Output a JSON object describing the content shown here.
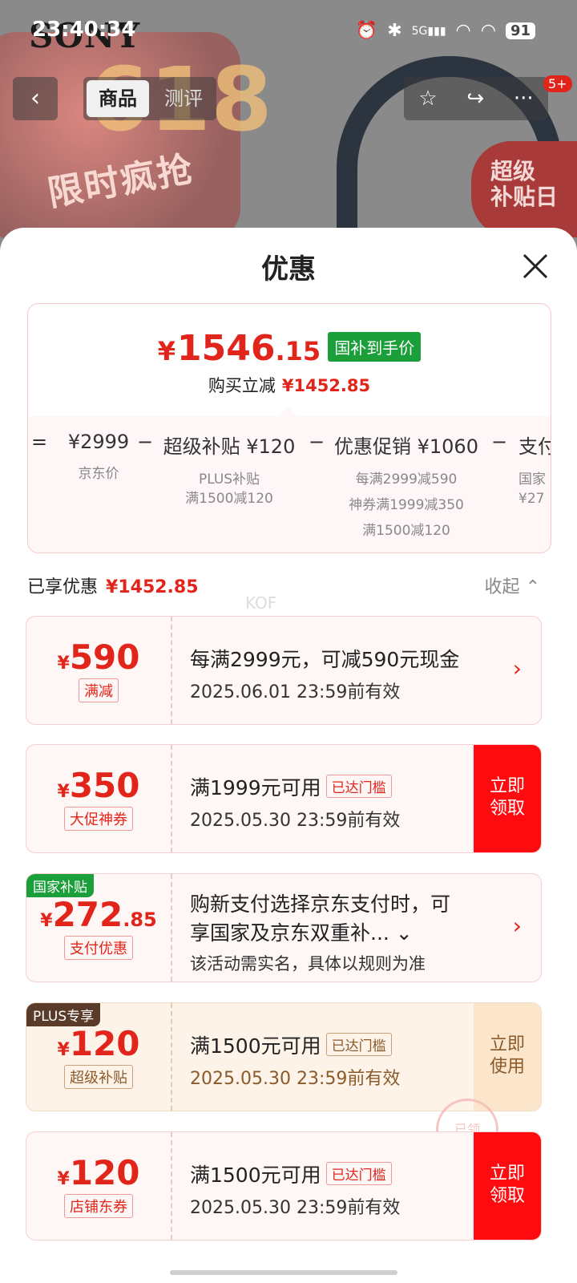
{
  "status": {
    "time": "23:40:34",
    "network": "5G",
    "battery": "91"
  },
  "background": {
    "brand": "SONY",
    "promo_big": "618",
    "promo_text": "限时疯抢",
    "badge": "超级\n补贴日"
  },
  "nav": {
    "tabs": [
      "商品",
      "测评"
    ],
    "badge": "5+"
  },
  "sheet": {
    "title": "优惠"
  },
  "summary": {
    "price_main": "1546",
    "price_decimal": ".15",
    "price_symbol": "¥",
    "price_tag": "国补到手价",
    "reduce_label": "购买立减",
    "reduce_amount": "¥1452.85",
    "breakdown": [
      {
        "value": "¥2999",
        "sub": [
          "京东价"
        ]
      },
      {
        "value": "超级补贴 ¥120",
        "sub": [
          "PLUS补贴",
          "满1500减120"
        ]
      },
      {
        "value": "优惠促销 ¥1060",
        "sub": [
          "每满2999减590",
          "神券满1999减350",
          "满1500减120"
        ]
      },
      {
        "value": "支付",
        "sub": [
          "国家",
          "¥27"
        ]
      }
    ]
  },
  "enjoyed": {
    "label": "已享优惠",
    "amount": "¥1452.85",
    "collapse": "收起"
  },
  "watermark": "KOF",
  "coupons": [
    {
      "amount": "590",
      "decimal": "",
      "tag": "满减",
      "line1": "每满2999元，可减590元现金",
      "line2": "2025.06.01 23:59前有效",
      "reached": "",
      "action": ""
    },
    {
      "amount": "350",
      "decimal": "",
      "tag": "大促神券",
      "line1": "满1999元可用",
      "line2": "2025.05.30 23:59前有效",
      "reached": "已达门槛",
      "action": "立即\n领取"
    },
    {
      "corner": "国家补贴",
      "amount": "272",
      "decimal": ".85",
      "tag": "支付优惠",
      "line1": "购新支付选择京东支付时，可",
      "line1b": "享国家及京东双重补...",
      "line2": "该活动需实名，具体以规则为准",
      "reached": "",
      "action": ""
    },
    {
      "corner": "PLUS专享",
      "amount": "120",
      "decimal": "",
      "tag": "超级补贴",
      "line1": "满1500元可用",
      "line2": "2025.05.30 23:59前有效",
      "reached": "已达门槛",
      "action": "立即\n使用"
    },
    {
      "amount": "120",
      "decimal": "",
      "tag": "店铺东券",
      "line1": "满1500元可用",
      "line2": "2025.05.30 23:59前有效",
      "reached": "已达门槛",
      "action": "立即\n领取"
    }
  ],
  "stamp": "已领",
  "colors": {
    "accent": "#e1251b",
    "green": "#1a9f3a",
    "button": "#ff0a0f",
    "gold_text": "#8a5a2b"
  }
}
